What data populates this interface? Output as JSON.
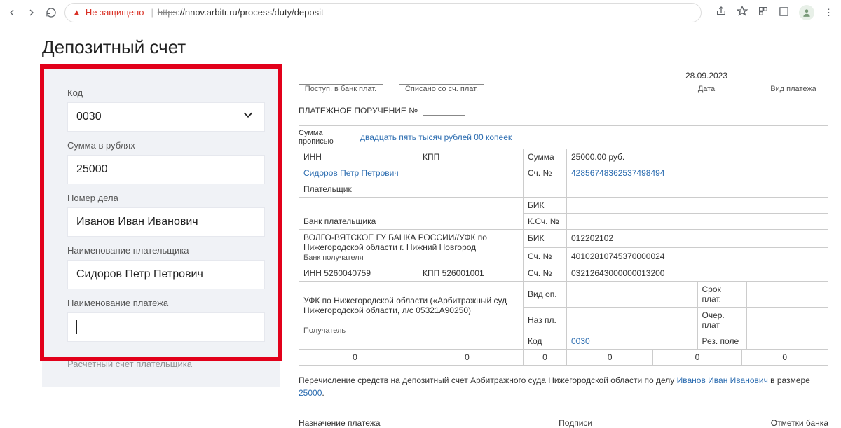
{
  "browser": {
    "not_secure": "Не защищено",
    "url_scheme": "https",
    "url_rest": "://nnov.arbitr.ru/process/duty/deposit"
  },
  "title": "Депозитный счет",
  "form": {
    "code_label": "Код",
    "code_value": "0030",
    "sum_label": "Сумма в рублях",
    "sum_value": "25000",
    "case_label": "Номер дела",
    "case_value": "Иванов Иван Иванович",
    "payer_label": "Наименование плательщика",
    "payer_value": "Сидоров Петр Петрович",
    "pay_name_label": "Наименование платежа",
    "account_label": "Расчетный счет плательщика"
  },
  "order": {
    "hdr_received": "Поступ. в банк плат.",
    "hdr_writeoff": "Списано со сч. плат.",
    "po_title": "ПЛАТЕЖНОЕ ПОРУЧЕНИЕ №",
    "date_value": "28.09.2023",
    "date_caption": "Дата",
    "paytype_caption": "Вид платежа",
    "sum_written_label": "Сумма прописью",
    "sum_written": "двадцать пять тысяч рублей 00 копеек",
    "labels": {
      "inn": "ИНН",
      "kpp": "КПП",
      "sum": "Сумма",
      "sch_no": "Сч. №",
      "payer": "Плательщик",
      "bik": "БИК",
      "payer_bank": "Банк плательщика",
      "ksch_no": "К.Сч. №",
      "recv_bank": "Банк получателя",
      "recipient": "Получатель",
      "vid_op": "Вид оп.",
      "naz_pl": "Наз пл.",
      "srok": "Срок плат.",
      "ocher": "Очер. плат",
      "kod": "Код",
      "rez": "Рез. поле"
    },
    "sum_value": "25000.00 руб.",
    "payer_name": "Сидоров Петр Петрович",
    "payer_account": "42856748362537498494",
    "recv_bank_name": "ВОЛГО-ВЯТСКОЕ ГУ БАНКА РОССИИ//УФК по Нижегородской области г. Нижний Новгород",
    "recv_bik": "012202102",
    "recv_sch": "40102810745370000024",
    "recv_inn": "ИНН 5260040759",
    "recv_kpp": "КПП 526001001",
    "recv_ksch": "03212643000000013200",
    "recipient_name": "УФК по Нижегородской области («Арбитражный суд Нижегородской области, л/с 05321А90250)",
    "kod_value": "0030",
    "zero": "0",
    "purpose_prefix": "Перечисление средств на депозитный счет Арбитражного суда Нижегородской области по делу ",
    "purpose_case": "Иванов Иван Иванович",
    "purpose_mid": " в размере ",
    "purpose_sum": "25000",
    "purpose_suffix": ".",
    "ftr_purpose": "Назначение платежа",
    "ftr_sign": "Подписи",
    "ftr_bank": "Отметки банка"
  }
}
